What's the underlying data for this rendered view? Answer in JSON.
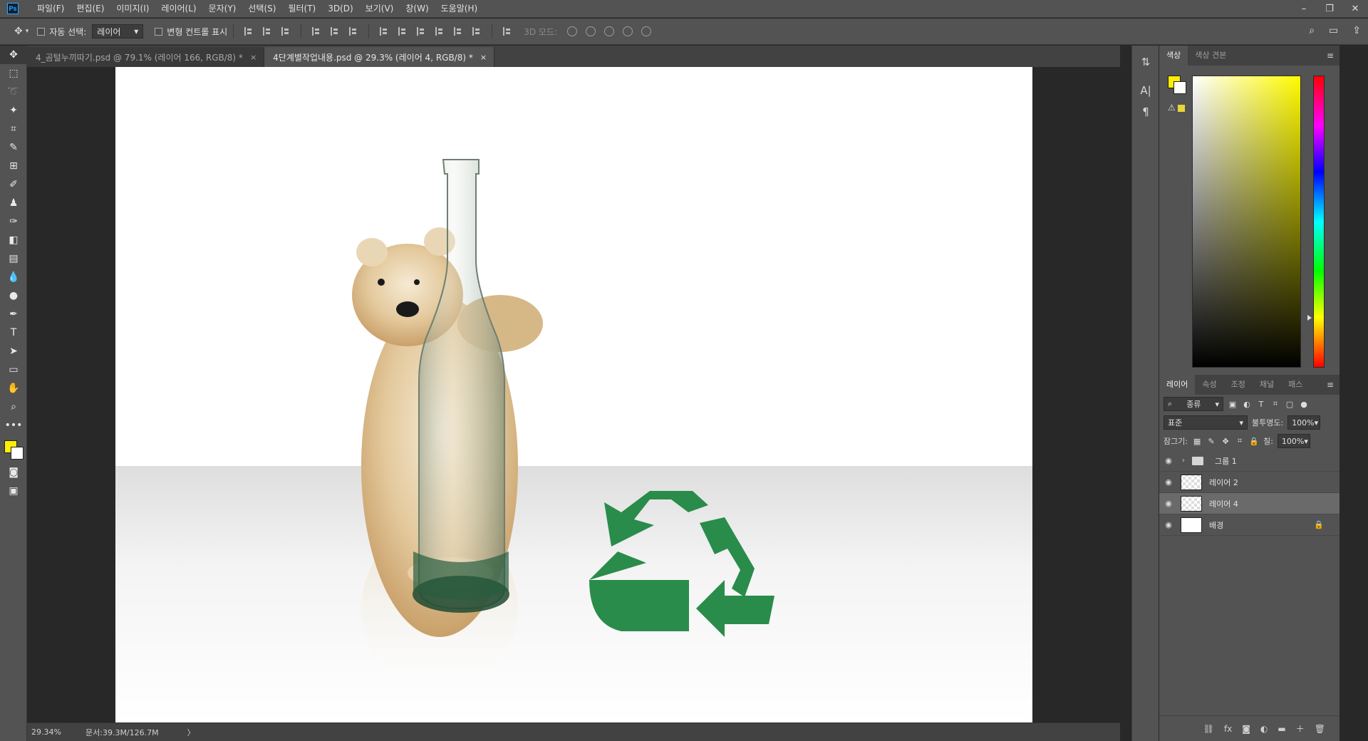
{
  "app": {
    "logo": "Ps"
  },
  "menu": [
    "파일(F)",
    "편집(E)",
    "이미지(I)",
    "레이어(L)",
    "문자(Y)",
    "선택(S)",
    "필터(T)",
    "3D(D)",
    "보기(V)",
    "창(W)",
    "도움말(H)"
  ],
  "options": {
    "auto_select_label": "자동 선택:",
    "auto_select_value": "레이어",
    "transform_label": "변형 컨트롤 표시",
    "mode3d_label": "3D 모드:"
  },
  "tabs": [
    {
      "label": "4_곰털누끼따기.psd @ 79.1% (레이어 166, RGB/8) *",
      "close": "×"
    },
    {
      "label": "4단계별작업내용.psd @ 29.3% (레이어 4, RGB/8) *",
      "close": "×"
    }
  ],
  "status": {
    "zoom": "29.34%",
    "doc": "문서:39.3M/126.7M",
    "arrow": "〉"
  },
  "color_panel": {
    "tabs": [
      "색상",
      "색상 견본"
    ],
    "foreground": "#ffee00",
    "background": "#ffffff"
  },
  "layers_panel": {
    "tabs": [
      "레이어",
      "속성",
      "조정",
      "채널",
      "패스"
    ],
    "filter_label": "종류",
    "blend_mode": "표준",
    "opacity_label": "불투명도:",
    "opacity_value": "100%",
    "lock_label": "잠그기:",
    "fill_label": "칠:",
    "fill_value": "100%",
    "layers": [
      {
        "name": "그룹 1",
        "type": "group"
      },
      {
        "name": "레이어 2",
        "type": "layer"
      },
      {
        "name": "레이어 4",
        "type": "layer",
        "selected": true
      },
      {
        "name": "배경",
        "type": "background",
        "locked": true
      }
    ]
  },
  "colors": {
    "recycle_green": "#2a8c4a",
    "accent": "#31a8ff"
  }
}
